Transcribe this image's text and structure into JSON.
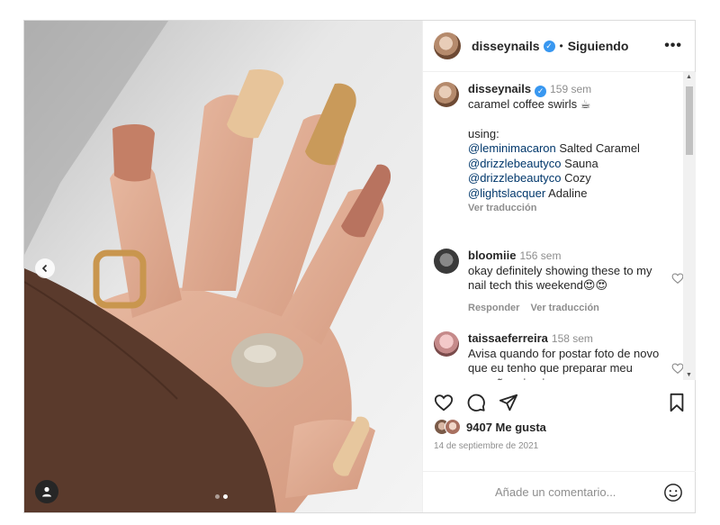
{
  "post": {
    "username": "disseynails",
    "separator": "•",
    "follow_status": "Siguiendo",
    "more_glyph": "•••"
  },
  "caption": {
    "username": "disseynails",
    "time": "159 sem",
    "line1": "caramel coffee swirls ☕",
    "using": "using:",
    "products": [
      {
        "mention": "@leminimacaron",
        "name": " Salted Caramel"
      },
      {
        "mention": "@drizzlebeautyco",
        "name": " Sauna"
      },
      {
        "mention": "@drizzlebeautyco",
        "name": " Cozy"
      },
      {
        "mention": "@lightslacquer",
        "name": " Adaline"
      }
    ],
    "translate": "Ver traducción"
  },
  "comments": [
    {
      "username": "bloomiie",
      "time": "156 sem",
      "text": "okay definitely showing these to my nail tech this weekend😍😍",
      "reply": "Responder",
      "translate": "Ver traducción"
    },
    {
      "username": "taissaeferreira",
      "time": "158 sem",
      "text": "Avisa quando for postar foto de novo que eu tenho que preparar meu coração primeiro."
    }
  ],
  "likes": {
    "text": "9407 Me gusta"
  },
  "date": "14 de septiembre de 2021",
  "add_comment": {
    "placeholder": "Añade un comentario..."
  },
  "icons": {
    "verified": "✓",
    "carousel_prev": "chevron-left-icon",
    "tag": "user-tag-icon",
    "like": "heart-icon",
    "comment": "comment-icon",
    "share": "paper-plane-icon",
    "save": "bookmark-icon",
    "emoji": "smiley-icon"
  },
  "carousel": {
    "count": 2,
    "active": 2
  },
  "colors": {
    "mention": "#00376b",
    "verified": "#3897f0",
    "muted": "#8e8e8e"
  }
}
